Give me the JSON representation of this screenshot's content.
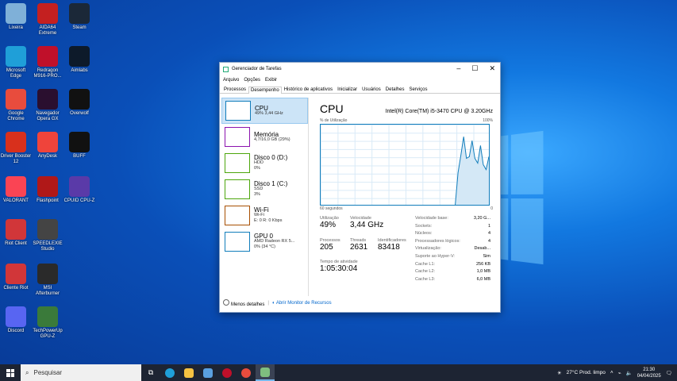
{
  "desktop": {
    "icons": [
      {
        "label": "Lixeira",
        "icon": "recycle-bin-icon",
        "color": "#7fb0d8"
      },
      {
        "label": "AIDA64 Extreme",
        "icon": "aida64-icon",
        "color": "#c42020"
      },
      {
        "label": "Steam",
        "icon": "steam-icon",
        "color": "#1b2838"
      },
      {
        "label": "Microsoft Edge",
        "icon": "edge-icon",
        "color": "#1f9fd8"
      },
      {
        "label": "Redragon M916-PRO...",
        "icon": "redragon-icon",
        "color": "#c0102a"
      },
      {
        "label": "Aimlabs",
        "icon": "aimlabs-icon",
        "color": "#0d1a2a"
      },
      {
        "label": "Google Chrome",
        "icon": "chrome-icon",
        "color": "#e84c3d"
      },
      {
        "label": "Navegador Opera GX",
        "icon": "opera-gx-icon",
        "color": "#2a0f2f"
      },
      {
        "label": "Overwolf",
        "icon": "overwolf-icon",
        "color": "#111"
      },
      {
        "label": "Driver Booster 12",
        "icon": "driver-booster-icon",
        "color": "#d8301c"
      },
      {
        "label": "AnyDesk",
        "icon": "anydesk-icon",
        "color": "#ef443b"
      },
      {
        "label": "BUFF",
        "icon": "buff-icon",
        "color": "#111"
      },
      {
        "label": "VALORANT",
        "icon": "valorant-icon",
        "color": "#fa4454"
      },
      {
        "label": "Flashpoint",
        "icon": "flashpoint-icon",
        "color": "#b01818"
      },
      {
        "label": "CPUID CPU-Z",
        "icon": "cpuz-icon",
        "color": "#5a3aa8"
      },
      {
        "label": "Riot Client",
        "icon": "riot-client-icon",
        "color": "#d13639"
      },
      {
        "label": "SPEEDLEXIE Studio",
        "icon": "speed-studio-icon",
        "color": "#444"
      },
      {
        "label": "Cliente Riot",
        "icon": "riot-client-icon-2",
        "color": "#d13639"
      },
      {
        "label": "MSI Afterburner",
        "icon": "afterburner-icon",
        "color": "#2a2a2a"
      },
      {
        "label": "Discord",
        "icon": "discord-icon",
        "color": "#5865f2"
      },
      {
        "label": "TechPowerUp GPU-Z",
        "icon": "gpuz-icon",
        "color": "#3a7a3a"
      }
    ]
  },
  "taskmanager": {
    "title": "Gerenciador de Tarefas",
    "menu": [
      "Arquivo",
      "Opções",
      "Exibir"
    ],
    "tabs": [
      "Processos",
      "Desempenho",
      "Histórico de aplicativos",
      "Inicializar",
      "Usuários",
      "Detalhes",
      "Serviços"
    ],
    "resources": [
      {
        "name": "CPU",
        "sub1": "49% 3,44 GHz",
        "sub2": "",
        "color": "#117dbb"
      },
      {
        "name": "Memória",
        "sub1": "4,7/16,0 GB (29%)",
        "sub2": "",
        "color": "#8b12ae"
      },
      {
        "name": "Disco 0 (D:)",
        "sub1": "HDD",
        "sub2": "0%",
        "color": "#4da60c"
      },
      {
        "name": "Disco 1 (C:)",
        "sub1": "SSD",
        "sub2": "3%",
        "color": "#4da60c"
      },
      {
        "name": "Wi-Fi",
        "sub1": "Wi-Fi",
        "sub2": "E: 0 R: 0 Kbps",
        "color": "#a74f01"
      },
      {
        "name": "GPU 0",
        "sub1": "AMD Radeon RX 5...",
        "sub2": "0% (34 °C)",
        "color": "#117dbb"
      }
    ],
    "cpu": {
      "title": "CPU",
      "model": "Intel(R) Core(TM) i5-3470 CPU @ 3.20GHz",
      "graph_label_left": "% de Utilização",
      "graph_label_right": "100%",
      "graph_foot_left": "60 segundos",
      "graph_foot_right": "0",
      "usage_values": [
        0,
        0,
        0,
        0,
        0,
        0,
        0,
        0,
        0,
        0,
        0,
        0,
        0,
        0,
        0,
        0,
        0,
        0,
        0,
        0,
        0,
        0,
        0,
        0,
        0,
        0,
        0,
        0,
        0,
        0,
        0,
        0,
        0,
        0,
        0,
        0,
        0,
        0,
        0,
        0,
        0,
        0,
        0,
        0,
        0,
        0,
        0,
        0,
        0,
        40,
        62,
        85,
        58,
        60,
        80,
        58,
        52,
        74,
        50,
        44,
        60
      ],
      "utilization_label": "Utilização",
      "utilization": "49%",
      "speed_label": "Velocidade",
      "speed": "3,44 GHz",
      "processes_label": "Processos",
      "processes": "205",
      "threads_label": "Threads",
      "threads": "2631",
      "handles_label": "Identificadores",
      "handles": "83418",
      "uptime_label": "Tempo de atividade",
      "uptime": "1:05:30:04",
      "details": [
        {
          "k": "Velocidade base:",
          "v": "3,20 G..."
        },
        {
          "k": "Sockets:",
          "v": "1"
        },
        {
          "k": "Núcleos:",
          "v": "4"
        },
        {
          "k": "Processadores lógicos:",
          "v": "4"
        },
        {
          "k": "Virtualização:",
          "v": "Desab..."
        },
        {
          "k": "Suporte ao Hyper-V:",
          "v": "Sim"
        },
        {
          "k": "Cache L1:",
          "v": "256 KB"
        },
        {
          "k": "Cache L2:",
          "v": "1,0 MB"
        },
        {
          "k": "Cache L3:",
          "v": "6,0 MB"
        }
      ]
    },
    "footer": {
      "less_details": "Menos detalhes",
      "resource_monitor": "Abrir Monitor de Recursos"
    }
  },
  "taskbar": {
    "search_placeholder": "Pesquisar",
    "weather": "27°C  Prod. limpo",
    "time": "21:30",
    "date": "04/04/2025"
  }
}
